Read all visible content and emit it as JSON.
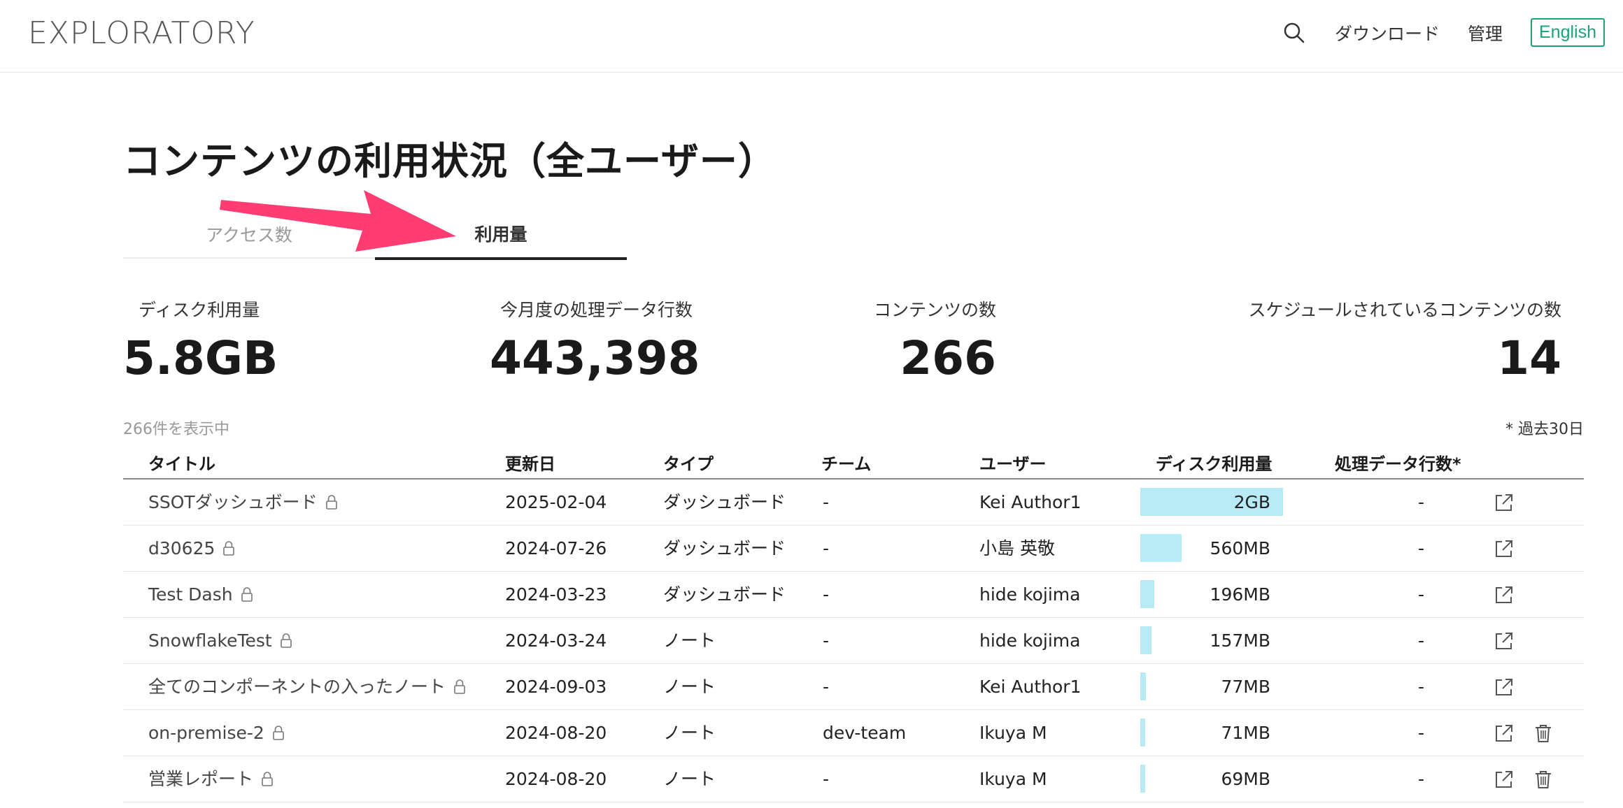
{
  "header": {
    "logo": "EXPLORATORY",
    "download": "ダウンロード",
    "admin": "管理",
    "language": "English"
  },
  "page": {
    "title": "コンテンツの利用状況（全ユーザー）",
    "tabs": [
      {
        "label": "アクセス数",
        "active": false
      },
      {
        "label": "利用量",
        "active": true
      }
    ]
  },
  "stats": [
    {
      "label": "ディスク利用量",
      "value": "5.8GB"
    },
    {
      "label": "今月度の処理データ行数",
      "value": "443,398"
    },
    {
      "label": "コンテンツの数",
      "value": "266"
    },
    {
      "label": "スケジュールされているコンテンツの数",
      "value": "14"
    }
  ],
  "list": {
    "showing": "266件を表示中",
    "note": "* 過去30日"
  },
  "table": {
    "columns": [
      "タイトル",
      "更新日",
      "タイプ",
      "チーム",
      "ユーザー",
      "ディスク利用量",
      "処理データ行数*"
    ],
    "rows": [
      {
        "title": "SSOTダッシュボード",
        "updated": "2025-02-04",
        "type": "ダッシュボード",
        "team": "-",
        "user": "Kei Author1",
        "disk": "2GB",
        "disk_fraction": 1.0,
        "rows": "-",
        "deletable": false
      },
      {
        "title": "d30625",
        "updated": "2024-07-26",
        "type": "ダッシュボード",
        "team": "-",
        "user": "小島 英敬",
        "disk": "560MB",
        "disk_fraction": 0.29,
        "rows": "-",
        "deletable": false
      },
      {
        "title": "Test Dash",
        "updated": "2024-03-23",
        "type": "ダッシュボード",
        "team": "-",
        "user": "hide kojima",
        "disk": "196MB",
        "disk_fraction": 0.1,
        "rows": "-",
        "deletable": false
      },
      {
        "title": "SnowflakeTest",
        "updated": "2024-03-24",
        "type": "ノート",
        "team": "-",
        "user": "hide kojima",
        "disk": "157MB",
        "disk_fraction": 0.08,
        "rows": "-",
        "deletable": false
      },
      {
        "title": "全てのコンポーネントの入ったノート",
        "updated": "2024-09-03",
        "type": "ノート",
        "team": "-",
        "user": "Kei Author1",
        "disk": "77MB",
        "disk_fraction": 0.04,
        "rows": "-",
        "deletable": false
      },
      {
        "title": "on-premise-2",
        "updated": "2024-08-20",
        "type": "ノート",
        "team": "dev-team",
        "user": "Ikuya M",
        "disk": "71MB",
        "disk_fraction": 0.036,
        "rows": "-",
        "deletable": true
      },
      {
        "title": "営業レポート",
        "updated": "2024-08-20",
        "type": "ノート",
        "team": "-",
        "user": "Ikuya M",
        "disk": "69MB",
        "disk_fraction": 0.035,
        "rows": "-",
        "deletable": true
      }
    ]
  },
  "colors": {
    "accent": "#1aa37a",
    "bar": "#b8ebf5",
    "arrow": "#ff3d73"
  }
}
